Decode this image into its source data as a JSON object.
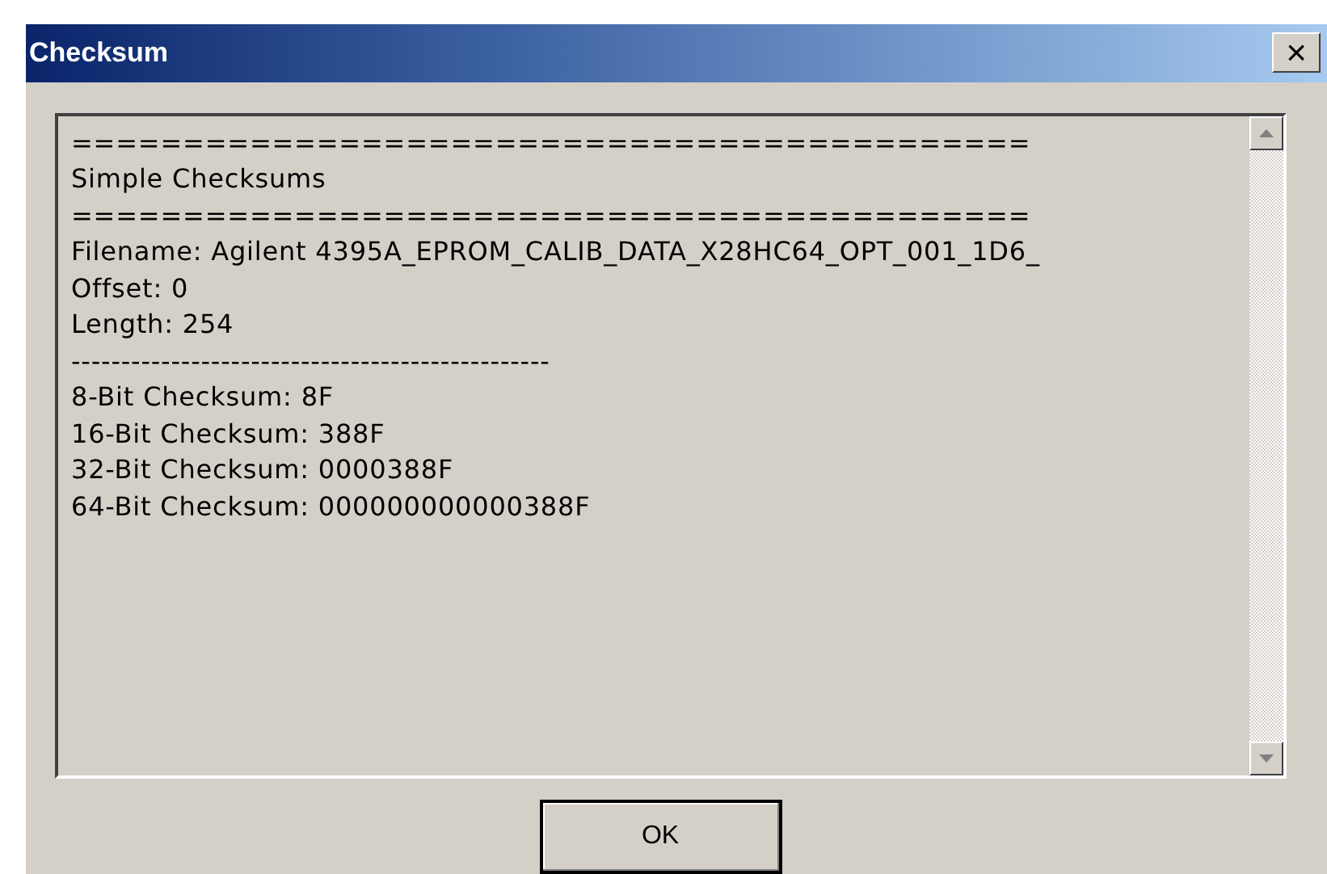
{
  "window": {
    "title": "Checksum",
    "close_label": "×"
  },
  "output": {
    "lines": [
      "===========================================",
      "Simple Checksums",
      "===========================================",
      "Filename: Agilent 4395A_EPROM_CALIB_DATA_X28HC64_OPT_001_1D6_",
      "Offset: 0",
      "Length: 254",
      "------------------------------------------------",
      "8-Bit Checksum: 8F",
      "16-Bit Checksum: 388F",
      "32-Bit Checksum: 0000388F",
      "64-Bit Checksum: 000000000000388F"
    ]
  },
  "buttons": [
    {
      "label": "OK",
      "default": true
    }
  ]
}
